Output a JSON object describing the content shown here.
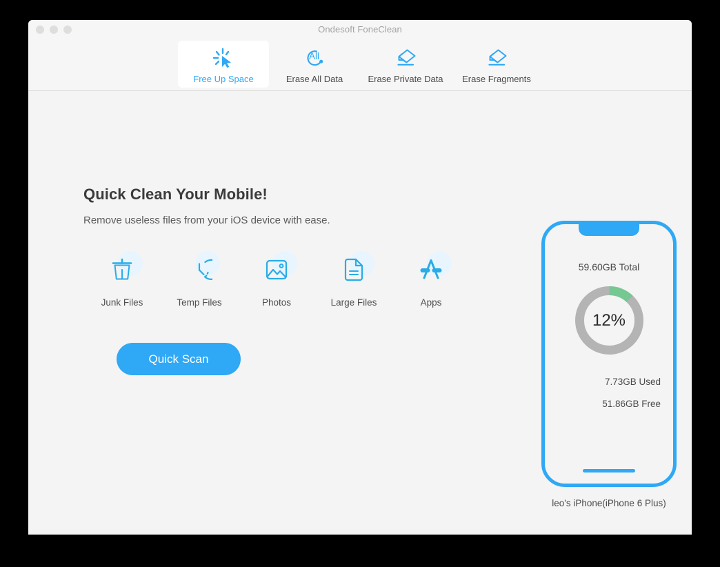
{
  "window": {
    "title": "Ondesoft FoneClean",
    "traffic_lights": [
      "close",
      "minimize",
      "zoom"
    ]
  },
  "toolbar": {
    "tabs": [
      {
        "label": "Free Up Space",
        "icon": "cursor-click-icon",
        "active": true
      },
      {
        "label": "Erase All Data",
        "icon": "erase-all-icon",
        "active": false
      },
      {
        "label": "Erase Private Data",
        "icon": "eraser-icon",
        "active": false
      },
      {
        "label": "Erase Fragments",
        "icon": "eraser-icon",
        "active": false
      }
    ]
  },
  "main": {
    "headline": "Quick Clean Your Mobile!",
    "subhead": "Remove useless files from your iOS device with ease.",
    "features": [
      {
        "label": "Junk Files",
        "icon": "trash-icon"
      },
      {
        "label": "Temp Files",
        "icon": "clock-icon"
      },
      {
        "label": "Photos",
        "icon": "photo-icon"
      },
      {
        "label": "Large Files",
        "icon": "document-icon"
      },
      {
        "label": "Apps",
        "icon": "app-store-icon"
      }
    ],
    "scan_button": "Quick Scan"
  },
  "device": {
    "total": "59.60GB Total",
    "percent_label": "12%",
    "used": "7.73GB Used",
    "free": "51.86GB Free",
    "name": "leo's iPhone(iPhone 6 Plus)"
  },
  "chart_data": {
    "type": "pie",
    "title": "Storage usage",
    "categories": [
      "Used",
      "Free"
    ],
    "values": [
      7.73,
      51.86
    ],
    "units": "GB",
    "percent_used": 12,
    "total": 59.6,
    "colors": [
      "#76c893",
      "#b4b4b4"
    ],
    "legend": "none",
    "center_label": "12%"
  },
  "colors": {
    "accent": "#2fa8f5",
    "donut_used": "#76c893",
    "donut_track": "#b4b4b4",
    "window_bg": "#f4f4f4",
    "toolbar_bg": "#f6f6f6",
    "text_primary": "#3b3b3b",
    "text_secondary": "#4a4a4a"
  }
}
